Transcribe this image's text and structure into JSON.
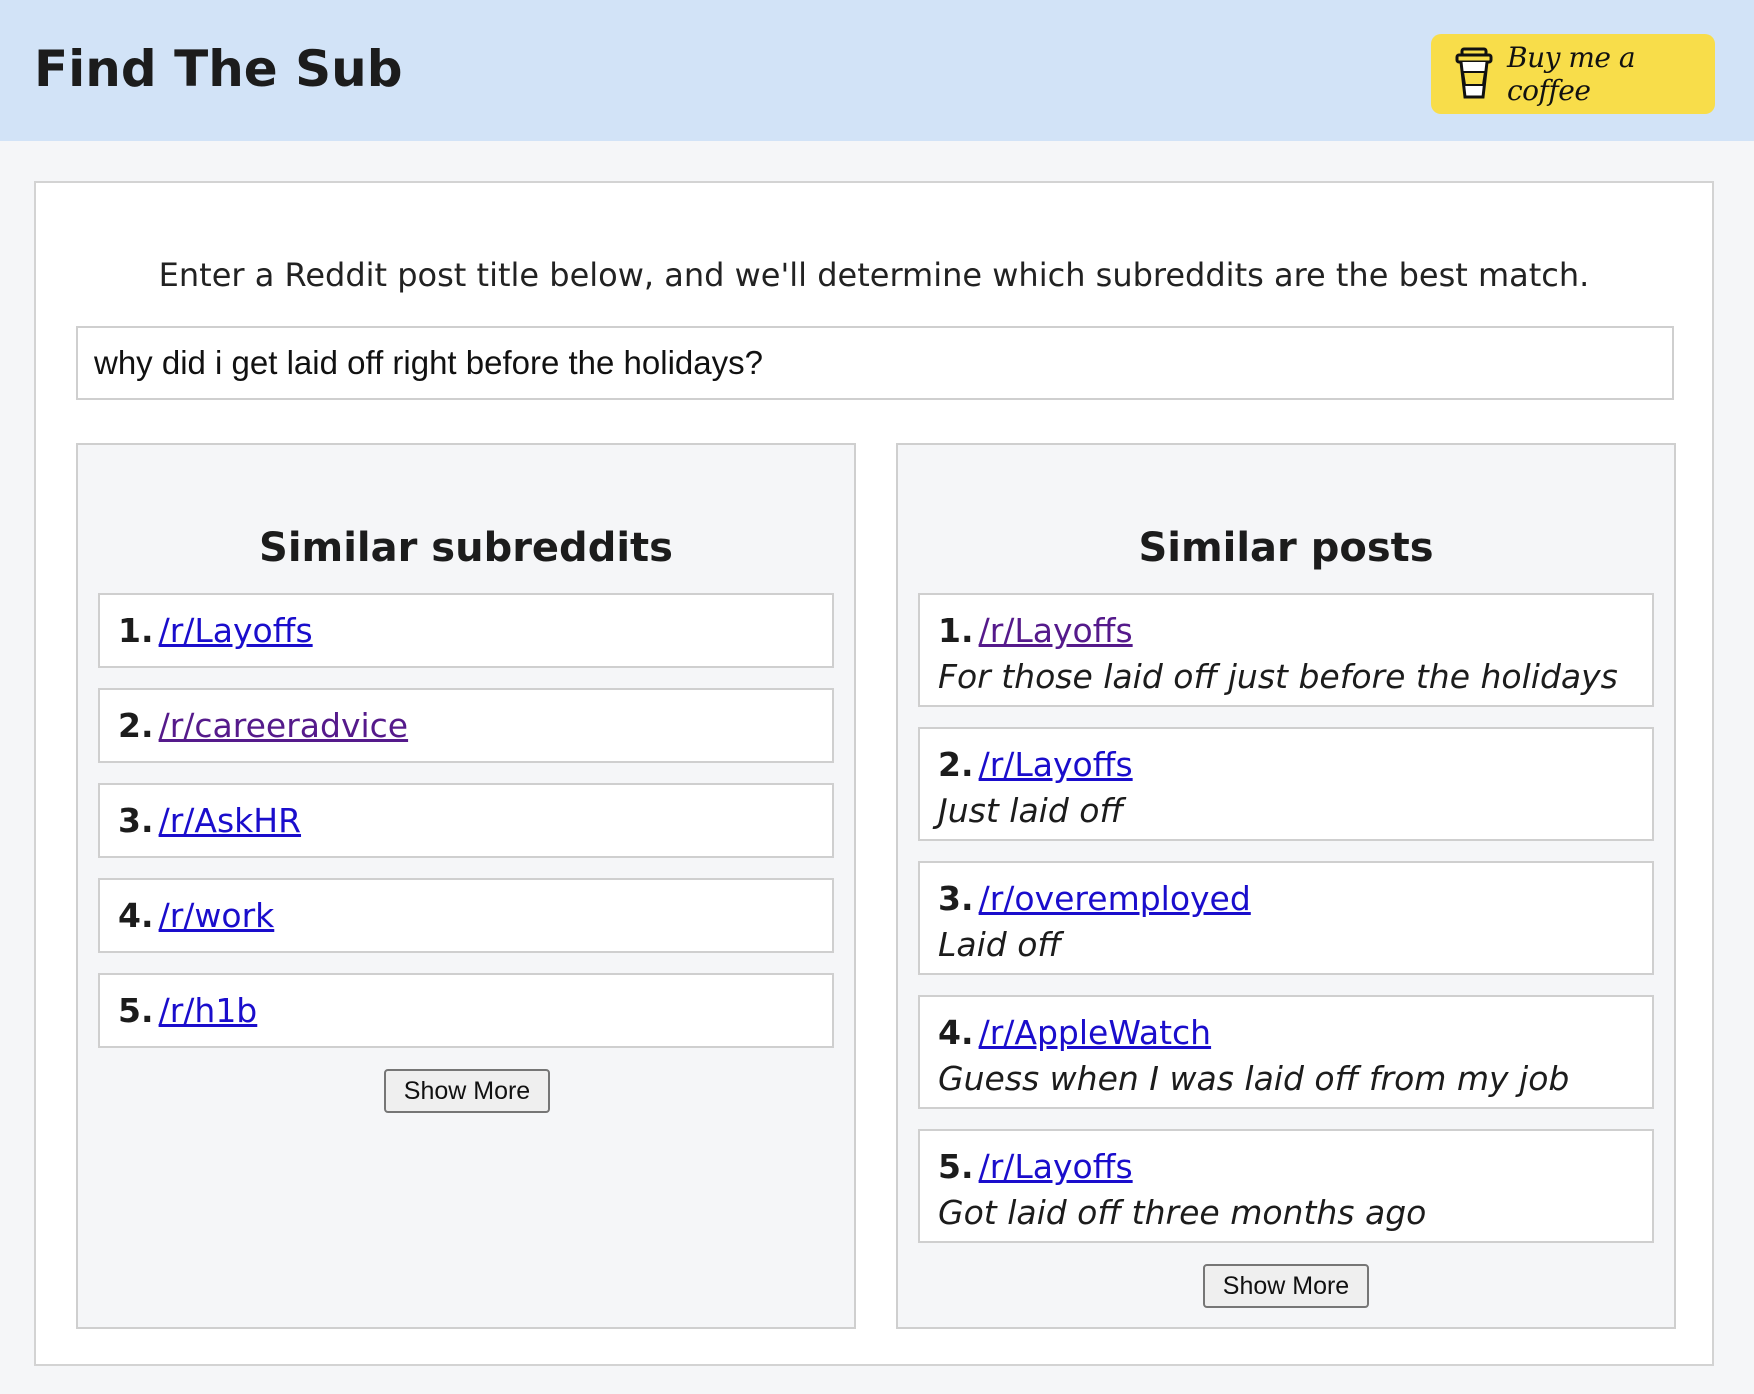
{
  "header": {
    "title": "Find The Sub",
    "coffee_label": "Buy me a coffee",
    "background": "#d2e3f7",
    "coffee_color": "#f8dd4a"
  },
  "intro": {
    "text": "Enter a Reddit post title below, and we'll determine which subreddits are the best match."
  },
  "search": {
    "value": "why did i get laid off right before the holidays?"
  },
  "subreddits": {
    "title": "Similar subreddits",
    "items": [
      {
        "num": "1.",
        "name": "/r/Layoffs",
        "visited": false
      },
      {
        "num": "2.",
        "name": "/r/careeradvice",
        "visited": true
      },
      {
        "num": "3.",
        "name": "/r/AskHR",
        "visited": false
      },
      {
        "num": "4.",
        "name": "/r/work",
        "visited": false
      },
      {
        "num": "5.",
        "name": "/r/h1b",
        "visited": false
      }
    ],
    "show_more": "Show More"
  },
  "posts": {
    "title": "Similar posts",
    "items": [
      {
        "num": "1.",
        "sub": "/r/Layoffs",
        "title": "For those laid off just before the holidays",
        "visited": true
      },
      {
        "num": "2.",
        "sub": "/r/Layoffs",
        "title": "Just laid off",
        "visited": false
      },
      {
        "num": "3.",
        "sub": "/r/overemployed",
        "title": "Laid off",
        "visited": false
      },
      {
        "num": "4.",
        "sub": "/r/AppleWatch",
        "title": "Guess when I was laid off from my job",
        "visited": false
      },
      {
        "num": "5.",
        "sub": "/r/Layoffs",
        "title": "Got laid off three months ago",
        "visited": false
      }
    ],
    "show_more": "Show More"
  },
  "colors": {
    "link": "#1a0dcc",
    "link_visited": "#551a8b"
  }
}
